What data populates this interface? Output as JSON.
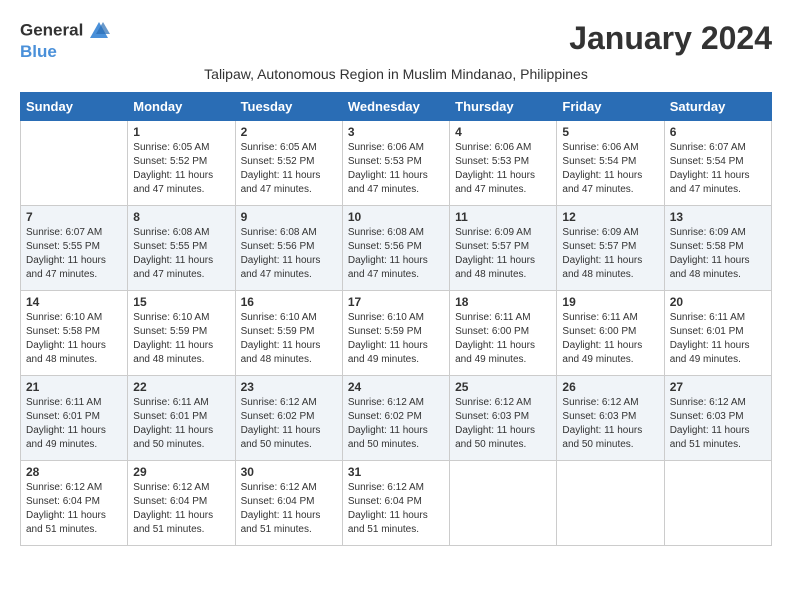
{
  "logo": {
    "line1": "General",
    "line2": "Blue"
  },
  "title": "January 2024",
  "subtitle": "Talipaw, Autonomous Region in Muslim Mindanao, Philippines",
  "days_of_week": [
    "Sunday",
    "Monday",
    "Tuesday",
    "Wednesday",
    "Thursday",
    "Friday",
    "Saturday"
  ],
  "weeks": [
    [
      {
        "day": "",
        "sunrise": "",
        "sunset": "",
        "daylight": ""
      },
      {
        "day": "1",
        "sunrise": "Sunrise: 6:05 AM",
        "sunset": "Sunset: 5:52 PM",
        "daylight": "Daylight: 11 hours and 47 minutes."
      },
      {
        "day": "2",
        "sunrise": "Sunrise: 6:05 AM",
        "sunset": "Sunset: 5:52 PM",
        "daylight": "Daylight: 11 hours and 47 minutes."
      },
      {
        "day": "3",
        "sunrise": "Sunrise: 6:06 AM",
        "sunset": "Sunset: 5:53 PM",
        "daylight": "Daylight: 11 hours and 47 minutes."
      },
      {
        "day": "4",
        "sunrise": "Sunrise: 6:06 AM",
        "sunset": "Sunset: 5:53 PM",
        "daylight": "Daylight: 11 hours and 47 minutes."
      },
      {
        "day": "5",
        "sunrise": "Sunrise: 6:06 AM",
        "sunset": "Sunset: 5:54 PM",
        "daylight": "Daylight: 11 hours and 47 minutes."
      },
      {
        "day": "6",
        "sunrise": "Sunrise: 6:07 AM",
        "sunset": "Sunset: 5:54 PM",
        "daylight": "Daylight: 11 hours and 47 minutes."
      }
    ],
    [
      {
        "day": "7",
        "sunrise": "Sunrise: 6:07 AM",
        "sunset": "Sunset: 5:55 PM",
        "daylight": "Daylight: 11 hours and 47 minutes."
      },
      {
        "day": "8",
        "sunrise": "Sunrise: 6:08 AM",
        "sunset": "Sunset: 5:55 PM",
        "daylight": "Daylight: 11 hours and 47 minutes."
      },
      {
        "day": "9",
        "sunrise": "Sunrise: 6:08 AM",
        "sunset": "Sunset: 5:56 PM",
        "daylight": "Daylight: 11 hours and 47 minutes."
      },
      {
        "day": "10",
        "sunrise": "Sunrise: 6:08 AM",
        "sunset": "Sunset: 5:56 PM",
        "daylight": "Daylight: 11 hours and 47 minutes."
      },
      {
        "day": "11",
        "sunrise": "Sunrise: 6:09 AM",
        "sunset": "Sunset: 5:57 PM",
        "daylight": "Daylight: 11 hours and 48 minutes."
      },
      {
        "day": "12",
        "sunrise": "Sunrise: 6:09 AM",
        "sunset": "Sunset: 5:57 PM",
        "daylight": "Daylight: 11 hours and 48 minutes."
      },
      {
        "day": "13",
        "sunrise": "Sunrise: 6:09 AM",
        "sunset": "Sunset: 5:58 PM",
        "daylight": "Daylight: 11 hours and 48 minutes."
      }
    ],
    [
      {
        "day": "14",
        "sunrise": "Sunrise: 6:10 AM",
        "sunset": "Sunset: 5:58 PM",
        "daylight": "Daylight: 11 hours and 48 minutes."
      },
      {
        "day": "15",
        "sunrise": "Sunrise: 6:10 AM",
        "sunset": "Sunset: 5:59 PM",
        "daylight": "Daylight: 11 hours and 48 minutes."
      },
      {
        "day": "16",
        "sunrise": "Sunrise: 6:10 AM",
        "sunset": "Sunset: 5:59 PM",
        "daylight": "Daylight: 11 hours and 48 minutes."
      },
      {
        "day": "17",
        "sunrise": "Sunrise: 6:10 AM",
        "sunset": "Sunset: 5:59 PM",
        "daylight": "Daylight: 11 hours and 49 minutes."
      },
      {
        "day": "18",
        "sunrise": "Sunrise: 6:11 AM",
        "sunset": "Sunset: 6:00 PM",
        "daylight": "Daylight: 11 hours and 49 minutes."
      },
      {
        "day": "19",
        "sunrise": "Sunrise: 6:11 AM",
        "sunset": "Sunset: 6:00 PM",
        "daylight": "Daylight: 11 hours and 49 minutes."
      },
      {
        "day": "20",
        "sunrise": "Sunrise: 6:11 AM",
        "sunset": "Sunset: 6:01 PM",
        "daylight": "Daylight: 11 hours and 49 minutes."
      }
    ],
    [
      {
        "day": "21",
        "sunrise": "Sunrise: 6:11 AM",
        "sunset": "Sunset: 6:01 PM",
        "daylight": "Daylight: 11 hours and 49 minutes."
      },
      {
        "day": "22",
        "sunrise": "Sunrise: 6:11 AM",
        "sunset": "Sunset: 6:01 PM",
        "daylight": "Daylight: 11 hours and 50 minutes."
      },
      {
        "day": "23",
        "sunrise": "Sunrise: 6:12 AM",
        "sunset": "Sunset: 6:02 PM",
        "daylight": "Daylight: 11 hours and 50 minutes."
      },
      {
        "day": "24",
        "sunrise": "Sunrise: 6:12 AM",
        "sunset": "Sunset: 6:02 PM",
        "daylight": "Daylight: 11 hours and 50 minutes."
      },
      {
        "day": "25",
        "sunrise": "Sunrise: 6:12 AM",
        "sunset": "Sunset: 6:03 PM",
        "daylight": "Daylight: 11 hours and 50 minutes."
      },
      {
        "day": "26",
        "sunrise": "Sunrise: 6:12 AM",
        "sunset": "Sunset: 6:03 PM",
        "daylight": "Daylight: 11 hours and 50 minutes."
      },
      {
        "day": "27",
        "sunrise": "Sunrise: 6:12 AM",
        "sunset": "Sunset: 6:03 PM",
        "daylight": "Daylight: 11 hours and 51 minutes."
      }
    ],
    [
      {
        "day": "28",
        "sunrise": "Sunrise: 6:12 AM",
        "sunset": "Sunset: 6:04 PM",
        "daylight": "Daylight: 11 hours and 51 minutes."
      },
      {
        "day": "29",
        "sunrise": "Sunrise: 6:12 AM",
        "sunset": "Sunset: 6:04 PM",
        "daylight": "Daylight: 11 hours and 51 minutes."
      },
      {
        "day": "30",
        "sunrise": "Sunrise: 6:12 AM",
        "sunset": "Sunset: 6:04 PM",
        "daylight": "Daylight: 11 hours and 51 minutes."
      },
      {
        "day": "31",
        "sunrise": "Sunrise: 6:12 AM",
        "sunset": "Sunset: 6:04 PM",
        "daylight": "Daylight: 11 hours and 51 minutes."
      },
      {
        "day": "",
        "sunrise": "",
        "sunset": "",
        "daylight": ""
      },
      {
        "day": "",
        "sunrise": "",
        "sunset": "",
        "daylight": ""
      },
      {
        "day": "",
        "sunrise": "",
        "sunset": "",
        "daylight": ""
      }
    ]
  ]
}
